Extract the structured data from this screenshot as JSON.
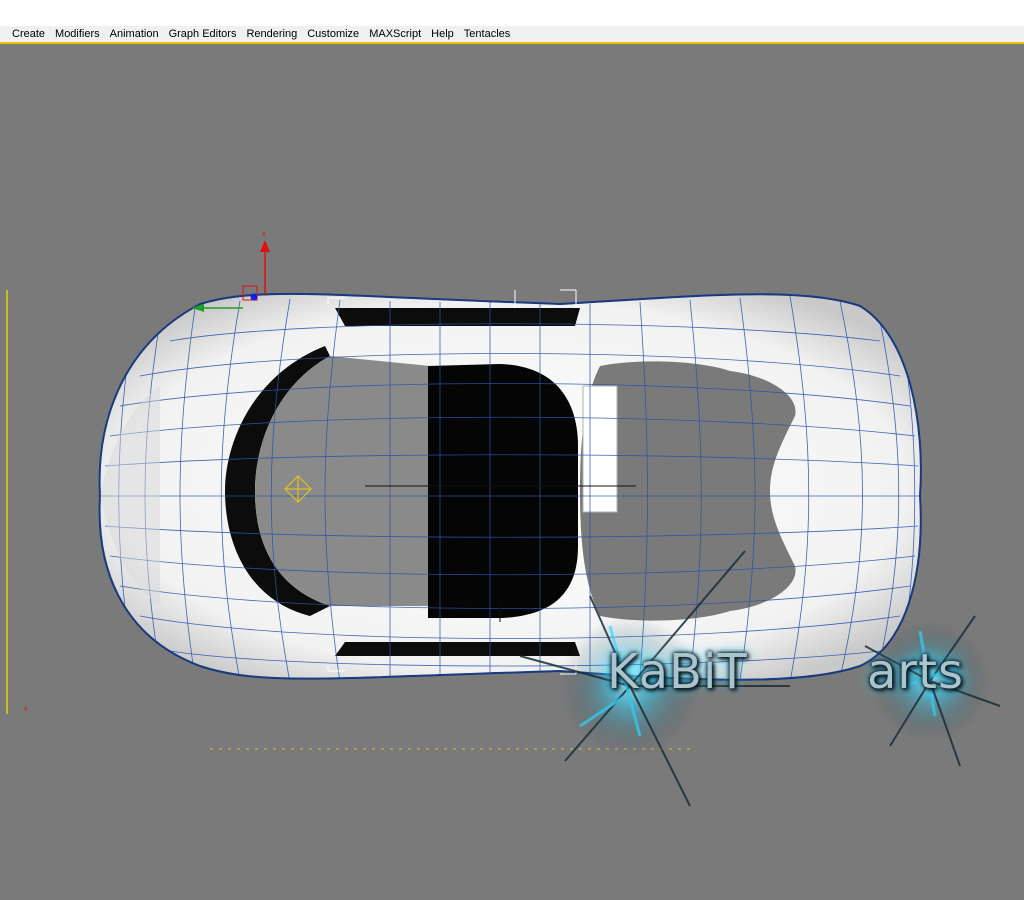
{
  "menu": {
    "items": [
      {
        "label": "Create"
      },
      {
        "label": "Modifiers"
      },
      {
        "label": "Animation"
      },
      {
        "label": "Graph Editors"
      },
      {
        "label": "Rendering"
      },
      {
        "label": "Customize"
      },
      {
        "label": "MAXScript"
      },
      {
        "label": "Help"
      },
      {
        "label": "Tentacles"
      }
    ]
  },
  "viewport": {
    "background_color": "#7a7a7a",
    "mesh_color": "#ffffff",
    "wire_color": "#2a55a8",
    "gizmo": {
      "x_axis_label": "x",
      "x_color": "#e01010",
      "y_color": "#20a020",
      "z_color": "#1020e0"
    },
    "world_axis_label": "x"
  },
  "watermark": {
    "word1": "KaBiT",
    "word2": "arts",
    "glow_color": "#2bd4ff"
  }
}
